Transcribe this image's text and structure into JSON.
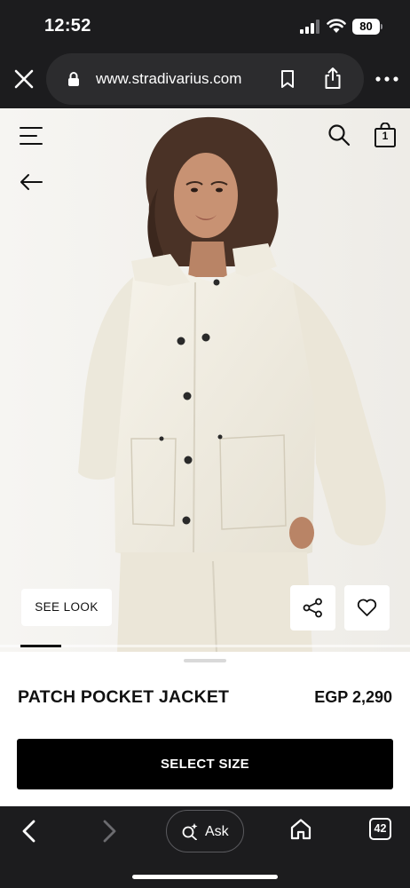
{
  "status_bar": {
    "time": "12:52",
    "battery": "80",
    "icons": [
      "signal-icon",
      "wifi-icon",
      "battery-icon"
    ]
  },
  "browser": {
    "url": "www.stradivarius.com",
    "icons": [
      "close-icon",
      "lock-icon",
      "bookmark-icon",
      "share-icon",
      "more-icon"
    ]
  },
  "header": {
    "bag_count": "1",
    "icons": [
      "menu-icon",
      "search-icon",
      "shopping-bag-icon",
      "back-arrow-icon"
    ]
  },
  "gallery": {
    "see_look_label": "SEE LOOK",
    "icons": [
      "share-icon",
      "heart-icon"
    ],
    "active_slide": 1
  },
  "product": {
    "name": "PATCH POCKET JACKET",
    "price": "EGP 2,290",
    "cta_label": "SELECT SIZE"
  },
  "toolbar": {
    "ask_label": "Ask",
    "tab_count": "42",
    "icons": [
      "chevron-left-icon",
      "chevron-right-icon",
      "sparkle-search-icon",
      "home-icon",
      "tabs-icon"
    ]
  },
  "colors": {
    "browser_chrome": "#1c1c1e",
    "url_pill": "#2c2c2e",
    "page_bg": "#ffffff",
    "cta_bg": "#000000",
    "photo_bg": "#f3f2ef",
    "jacket": "#f2efe4"
  }
}
